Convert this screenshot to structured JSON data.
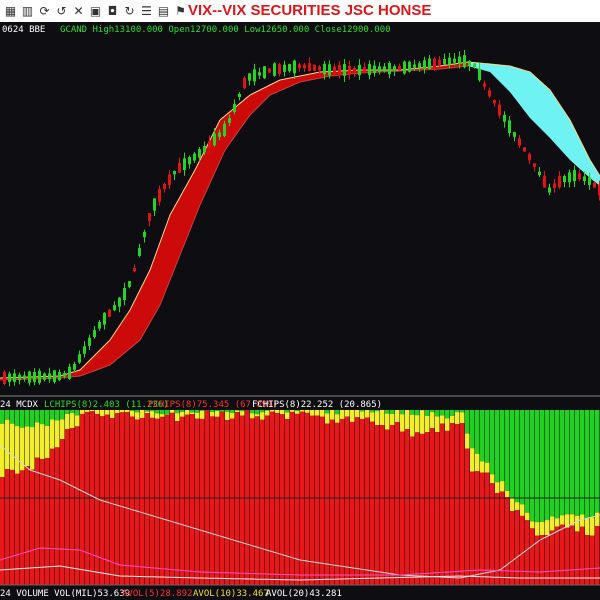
{
  "window": {
    "title": "VIX--VIX SECURITIES JSC  HONSE",
    "toolbar_icons": [
      "grid-icon",
      "bar-chart-icon",
      "sync-icon",
      "undo-icon",
      "tools-icon",
      "camera-icon",
      "briefcase-icon",
      "refresh-icon",
      "list-icon",
      "document-icon",
      "bookmark-icon"
    ]
  },
  "colors": {
    "background": "#0d0d12",
    "candle_up": "#22d622",
    "candle_down": "#e01414",
    "cloud_up": "#cc0a0a",
    "cloud_down": "#6ff2f2",
    "chips_red": "#e8181a",
    "chips_green": "#22d022",
    "chips_yellow": "#f2ef2a",
    "legend_green": "#22e022",
    "legend_red": "#ff3030",
    "legend_yellow": "#f0e020",
    "legend_white": "#ffffff"
  },
  "price_panel": {
    "header": {
      "left": "0624 BBE",
      "gcand": "GCAND High13100.000 Open12700.000 Low12650.000 Close12900.000"
    }
  },
  "chips_panel": {
    "header": {
      "label": "24 MCDX",
      "lchips": "LCHIPS(8)2.403 (11.236)",
      "pchips": "PCHIPS(8)75.345 (67.899)",
      "fchips": "FCHIPS(8)22.252 (20.865)"
    }
  },
  "volume_panel": {
    "header": {
      "label": "24 VOLUME VOL(MIL)53.639",
      "avol5": "AVOL(5)28.892",
      "avol10": "AVOL(10)33.467",
      "avol20": "AVOL(20)43.281"
    }
  },
  "chart_data": [
    {
      "type": "candlestick",
      "title": "GCAND",
      "trend": "price series drawn as candlesticks with a filled band between two moving averages",
      "last_bar": {
        "high": 13100,
        "open": 12700,
        "low": 12650,
        "close": 12900
      },
      "grid": false
    },
    {
      "type": "area",
      "title": "MCDX",
      "series": [
        {
          "name": "LCHIPS(8)",
          "value": 2.403,
          "prev": 11.236
        },
        {
          "name": "PCHIPS(8)",
          "value": 75.345,
          "prev": 67.899
        },
        {
          "name": "FCHIPS(8)",
          "value": 22.252,
          "prev": 20.865
        }
      ],
      "ylim": [
        0,
        100
      ]
    },
    {
      "type": "line",
      "title": "VOLUME",
      "series": [
        {
          "name": "VOL(MIL)",
          "value": 53.639
        },
        {
          "name": "AVOL(5)",
          "value": 28.892
        },
        {
          "name": "AVOL(10)",
          "value": 33.467
        },
        {
          "name": "AVOL(20)",
          "value": 43.281
        }
      ]
    }
  ]
}
